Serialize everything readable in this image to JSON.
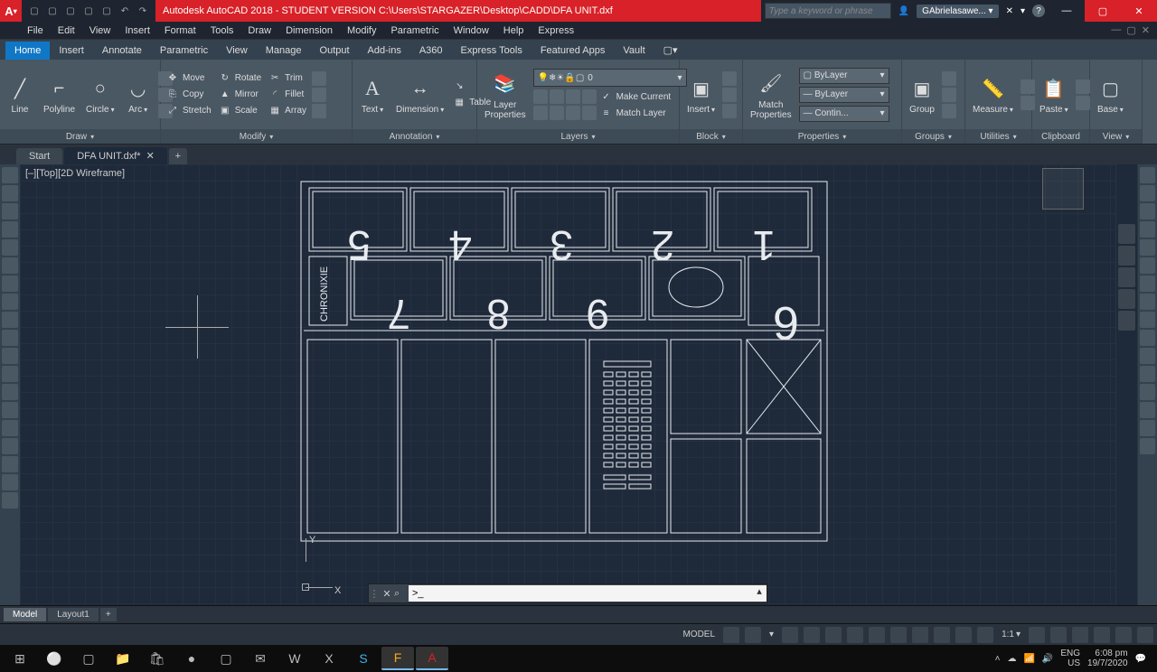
{
  "titlebar": {
    "app_letter": "A",
    "title": "Autodesk AutoCAD 2018 - STUDENT VERSION   C:\\Users\\STARGAZER\\Desktop\\CADD\\DFA UNIT.dxf",
    "search_placeholder": "Type a keyword or phrase",
    "user": "GAbrielasawe..."
  },
  "menubar": {
    "items": [
      "File",
      "Edit",
      "View",
      "Insert",
      "Format",
      "Tools",
      "Draw",
      "Dimension",
      "Modify",
      "Parametric",
      "Window",
      "Help",
      "Express"
    ]
  },
  "ribtabs": {
    "items": [
      "Home",
      "Insert",
      "Annotate",
      "Parametric",
      "View",
      "Manage",
      "Output",
      "Add-ins",
      "A360",
      "Express Tools",
      "Featured Apps",
      "Vault"
    ],
    "active": 0
  },
  "ribbon": {
    "draw": {
      "label": "Draw",
      "line": "Line",
      "polyline": "Polyline",
      "circle": "Circle",
      "arc": "Arc"
    },
    "modify": {
      "label": "Modify",
      "move": "Move",
      "rotate": "Rotate",
      "trim": "Trim",
      "copy": "Copy",
      "mirror": "Mirror",
      "fillet": "Fillet",
      "stretch": "Stretch",
      "scale": "Scale",
      "array": "Array"
    },
    "annotation": {
      "label": "Annotation",
      "text": "Text",
      "dimension": "Dimension",
      "table": "Table"
    },
    "layers": {
      "label": "Layers",
      "props": "Layer\nProperties",
      "current": "0",
      "make": "Make Current",
      "match": "Match Layer"
    },
    "block": {
      "label": "Block",
      "insert": "Insert"
    },
    "properties": {
      "label": "Properties",
      "match": "Match\nProperties",
      "bylayer": "ByLayer",
      "layer2": "ByLayer",
      "contin": "Contin..."
    },
    "groups": {
      "label": "Groups",
      "group": "Group"
    },
    "utilities": {
      "label": "Utilities",
      "measure": "Measure"
    },
    "clipboard": {
      "label": "Clipboard",
      "paste": "Paste"
    },
    "view": {
      "label": "View",
      "base": "Base"
    }
  },
  "filetabs": {
    "start": "Start",
    "file": "DFA UNIT.dxf*"
  },
  "viewport": {
    "label": "[–][Top][2D Wireframe]"
  },
  "axes": {
    "x": "X",
    "y": "Y"
  },
  "drawing_text": {
    "chronixie": "CHRONIXIE"
  },
  "layouttabs": {
    "model": "Model",
    "layout1": "Layout1"
  },
  "statusbar": {
    "model": "MODEL",
    "scale": "1:1"
  },
  "taskbar": {
    "lang": "ENG",
    "locale": "US",
    "time": "6:08 pm",
    "date": "19/7/2020"
  }
}
